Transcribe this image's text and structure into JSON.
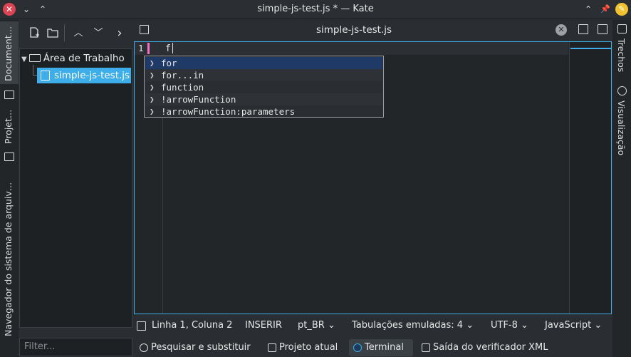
{
  "titlebar": {
    "title": "simple-js-test.js * — Kate",
    "close_glyph": "✕",
    "menu_glyph": "⌄",
    "up_glyph": "⌃",
    "keep_above_glyph": "⌃",
    "pin_glyph": "📌",
    "yellow_glyph": "✎"
  },
  "left_tabs": {
    "documents": "Document…",
    "projects": "Projet…",
    "filesystem": "Navegador do sistema de arquiv…"
  },
  "left_panel": {
    "toolbar": {
      "up_glyph": "︿",
      "down_glyph": "﹀",
      "next_glyph": "›"
    },
    "tree_root": "Área de Trabalho",
    "tree_file": "simple-js-test.js",
    "filter_placeholder": "Filter..."
  },
  "editor": {
    "tab_title": "simple-js-test.js",
    "close_glyph": "✕",
    "line_number": "1",
    "code_text": "f",
    "completion_items": [
      "for",
      "for...in",
      "function",
      "!arrowFunction",
      "!arrowFunction:parameters"
    ],
    "chevron_glyph": "❯"
  },
  "right_tabs": {
    "snippets": "Trechos",
    "preview": "Visualização"
  },
  "statusbar": {
    "position": "Linha 1, Coluna 2",
    "mode": "INSERIR",
    "language": "pt_BR",
    "tabs": "Tabulações emuladas: 4",
    "encoding": "UTF-8",
    "syntax": "JavaScript",
    "dropdown_glyph": "⌄"
  },
  "bottom_tabs": {
    "search": "Pesquisar e substituir",
    "project": "Projeto atual",
    "terminal": "Terminal",
    "linter": "Saída do verificador XML"
  },
  "colors": {
    "accent": "#3daee9",
    "close_red": "#da4453",
    "modified_marker": "#f66fc4",
    "selection": "#1f3a66"
  }
}
